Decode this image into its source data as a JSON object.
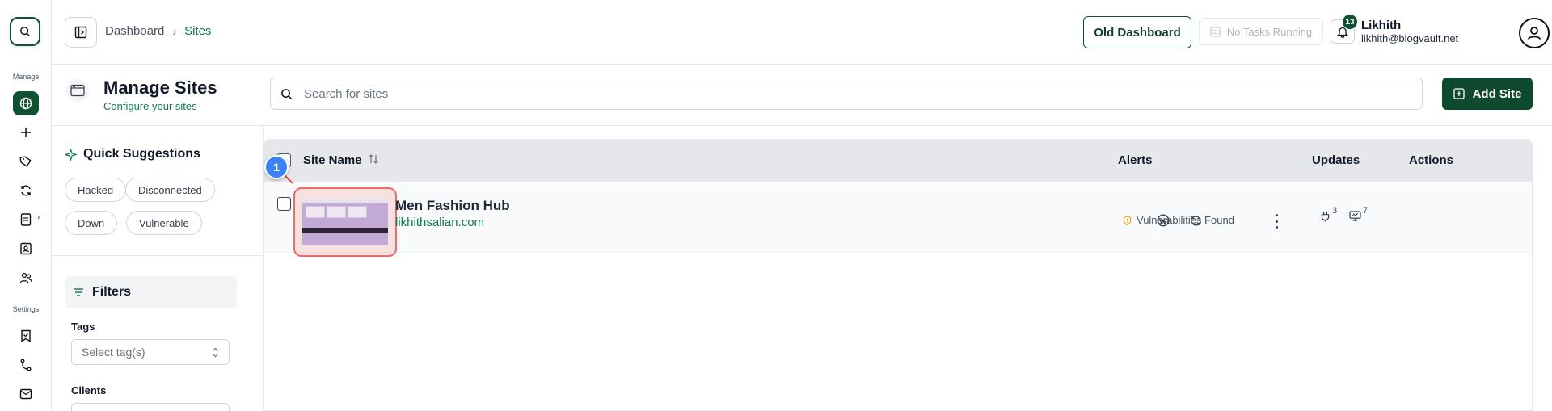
{
  "rail": {
    "manage_label": "Manage",
    "settings_label": "Settings"
  },
  "topbar": {
    "breadcrumb": [
      "Dashboard",
      "Sites"
    ],
    "old_dashboard": "Old Dashboard",
    "tasks_status": "No Tasks Running",
    "notification_count": "13",
    "user_name": "Likhith",
    "user_email": "likhith@blogvault.net"
  },
  "page": {
    "title": "Manage Sites",
    "subtitle": "Configure your sites",
    "search_placeholder": "Search for sites",
    "add_site": "Add Site"
  },
  "sidebar": {
    "quick_suggestions_title": "Quick Suggestions",
    "chips": [
      "Hacked",
      "Disconnected",
      "Down",
      "Vulnerable"
    ],
    "filters_title": "Filters",
    "tags_label": "Tags",
    "tags_placeholder": "Select tag(s)",
    "clients_label": "Clients"
  },
  "table": {
    "columns": [
      "Site Name",
      "Alerts",
      "Updates",
      "Actions"
    ],
    "rows": [
      {
        "name": "Men Fashion Hub",
        "url": "likhithsalian.com",
        "alert": "Vulnerabilities Found",
        "plugin_updates": "3",
        "theme_updates": "7"
      }
    ]
  },
  "overlay": {
    "step_number": "1"
  },
  "colors": {
    "brand": "#0f5132",
    "accent_text": "#0f7a4c",
    "highlight": "#ef6b6b",
    "marker": "#3b82f6"
  }
}
